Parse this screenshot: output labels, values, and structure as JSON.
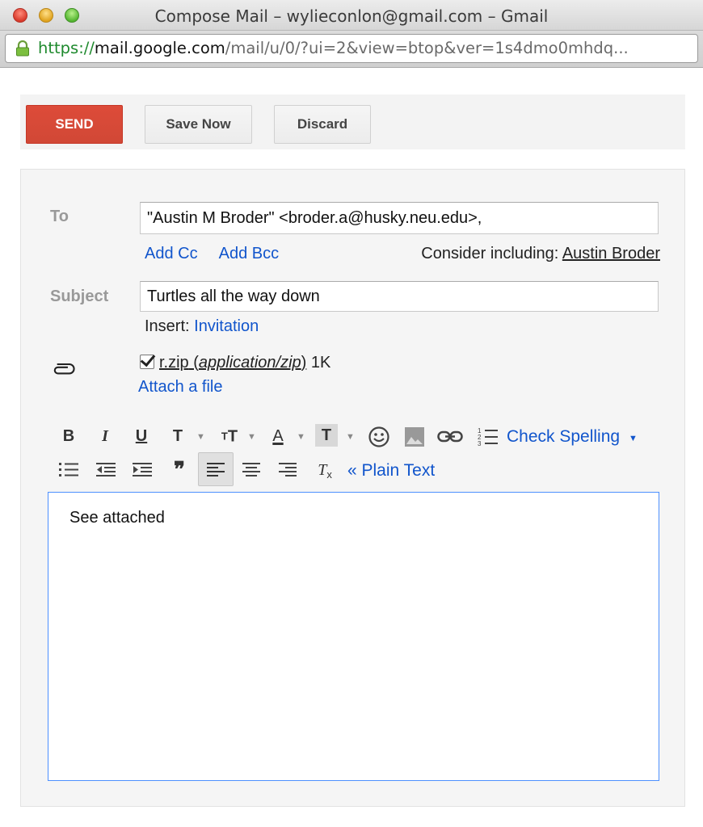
{
  "window": {
    "title": "Compose Mail – wylieconlon@gmail.com – Gmail",
    "url_scheme": "https://",
    "url_host": "mail.google.com",
    "url_path": "/mail/u/0/?ui=2&view=btop&ver=1s4dmo0mhdq..."
  },
  "actions": {
    "send": "SEND",
    "save": "Save Now",
    "discard": "Discard"
  },
  "to": {
    "label": "To",
    "value": "\"Austin M Broder\" <broder.a@husky.neu.edu>,",
    "add_cc": "Add Cc",
    "add_bcc": "Add Bcc",
    "consider_prefix": "Consider including: ",
    "consider_name": "Austin Broder"
  },
  "subject": {
    "label": "Subject",
    "value": "Turtles all the way down",
    "insert_prefix": "Insert: ",
    "insert_link": "Invitation"
  },
  "attachment": {
    "checked": true,
    "name": "r.zip",
    "type_open": " (",
    "type": "application/zip",
    "type_close": ")",
    "size": " 1K",
    "attach_link": "Attach a file"
  },
  "formatting": {
    "bold": "B",
    "italic": "I",
    "underline": "U",
    "font": "T",
    "size": "T",
    "text_color": "A",
    "highlight": "T",
    "check_spelling": "Check Spelling",
    "plain_text": "« Plain Text"
  },
  "body": {
    "text": "See attached"
  },
  "colors": {
    "send": "#d14836",
    "link": "#1155cc",
    "editor_border": "#4d90fe"
  }
}
